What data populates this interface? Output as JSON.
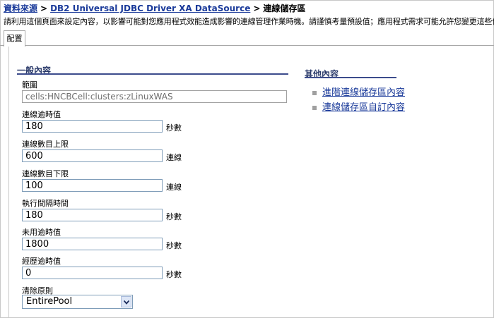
{
  "breadcrumb": {
    "items": [
      "資料來源",
      "DB2 Universal JDBC Driver XA DataSource"
    ],
    "current": "連線儲存區",
    "separator": ">"
  },
  "description": "請利用這個頁面來設定內容，以影響可能對您應用程式效能造成影響的連線管理作業時機。請謹慎考量預設值；應用程式需求可能允許您變更這些值。",
  "tabs": [
    {
      "label": "配置",
      "active": true
    }
  ],
  "general": {
    "title": "一般內容",
    "scope_label": "範圍",
    "scope_value": "cells:HNCBCell:clusters:zLinuxWAS",
    "fields": [
      {
        "label": "連線逾時值",
        "value": "180",
        "unit": "秒數"
      },
      {
        "label": "連線數目上限",
        "value": "600",
        "unit": "連線"
      },
      {
        "label": "連線數目下限",
        "value": "100",
        "unit": "連線"
      },
      {
        "label": "執行間隔時間",
        "value": "180",
        "unit": "秒數"
      },
      {
        "label": "未用逾時值",
        "value": "1800",
        "unit": "秒數"
      },
      {
        "label": "經歷逾時值",
        "value": "0",
        "unit": "秒數"
      }
    ],
    "purge_label": "清除原則",
    "purge_value": "EntirePool"
  },
  "other": {
    "title": "其他內容",
    "links": [
      "進階連線儲存區內容",
      "連線儲存區自訂內容"
    ]
  },
  "colors": {
    "link": "#1a3a9a",
    "section_title": "#2a3a6a",
    "section_rule": "#3c4c8c",
    "input_border": "#7f9db9"
  },
  "icons": [
    "chevron-down-icon",
    "bullet-square-icon"
  ]
}
